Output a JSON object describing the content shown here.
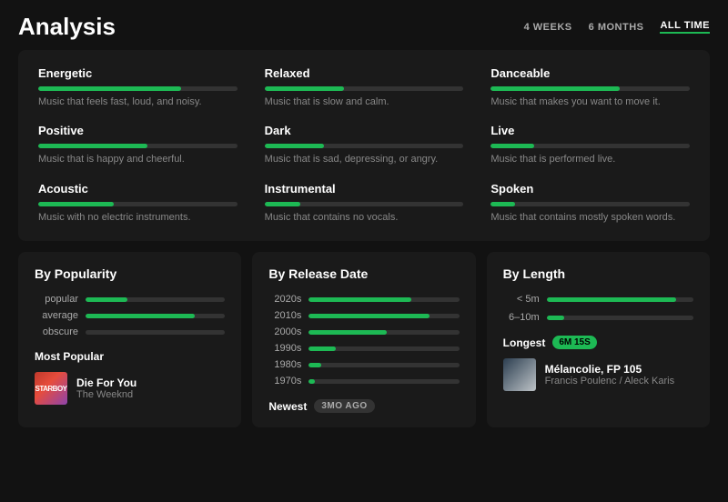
{
  "header": {
    "title": "Analysis",
    "time_filters": [
      {
        "label": "4 WEEKS",
        "active": false
      },
      {
        "label": "6 MONTHS",
        "active": false
      },
      {
        "label": "ALL TIME",
        "active": true
      }
    ]
  },
  "attributes": [
    {
      "label": "Energetic",
      "fill_pct": 72,
      "description": "Music that feels fast, loud, and noisy."
    },
    {
      "label": "Relaxed",
      "fill_pct": 40,
      "description": "Music that is slow and calm."
    },
    {
      "label": "Danceable",
      "fill_pct": 65,
      "description": "Music that makes you want to move it."
    },
    {
      "label": "Positive",
      "fill_pct": 55,
      "description": "Music that is happy and cheerful."
    },
    {
      "label": "Dark",
      "fill_pct": 30,
      "description": "Music that is sad, depressing, or angry."
    },
    {
      "label": "Live",
      "fill_pct": 22,
      "description": "Music that is performed live."
    },
    {
      "label": "Acoustic",
      "fill_pct": 38,
      "description": "Music with no electric instruments."
    },
    {
      "label": "Instrumental",
      "fill_pct": 18,
      "description": "Music that contains no vocals."
    },
    {
      "label": "Spoken",
      "fill_pct": 12,
      "description": "Music that contains mostly spoken words."
    }
  ],
  "popularity": {
    "title": "By Popularity",
    "bars": [
      {
        "label": "popular",
        "fill_pct": 30
      },
      {
        "label": "average",
        "fill_pct": 78
      },
      {
        "label": "obscure",
        "fill_pct": 0
      }
    ],
    "most_popular_label": "Most Popular",
    "most_popular_track": {
      "name": "Die For You",
      "artist": "The Weeknd",
      "thumb_text": "STARBOY"
    }
  },
  "release_date": {
    "title": "By Release Date",
    "bars": [
      {
        "label": "2020s",
        "fill_pct": 68
      },
      {
        "label": "2010s",
        "fill_pct": 80
      },
      {
        "label": "2000s",
        "fill_pct": 52
      },
      {
        "label": "1990s",
        "fill_pct": 18
      },
      {
        "label": "1980s",
        "fill_pct": 8
      },
      {
        "label": "1970s",
        "fill_pct": 4
      }
    ],
    "newest_label": "Newest",
    "newest_badge": "3MO AGO"
  },
  "length": {
    "title": "By Length",
    "bars": [
      {
        "label": "< 5m",
        "fill_pct": 88
      },
      {
        "label": "6–10m",
        "fill_pct": 12
      }
    ],
    "longest_label": "Longest",
    "longest_badge": "6M 15S",
    "longest_track": {
      "name": "Mélancolie, FP 105",
      "artist": "Francis Poulenc / Aleck Karis"
    }
  }
}
